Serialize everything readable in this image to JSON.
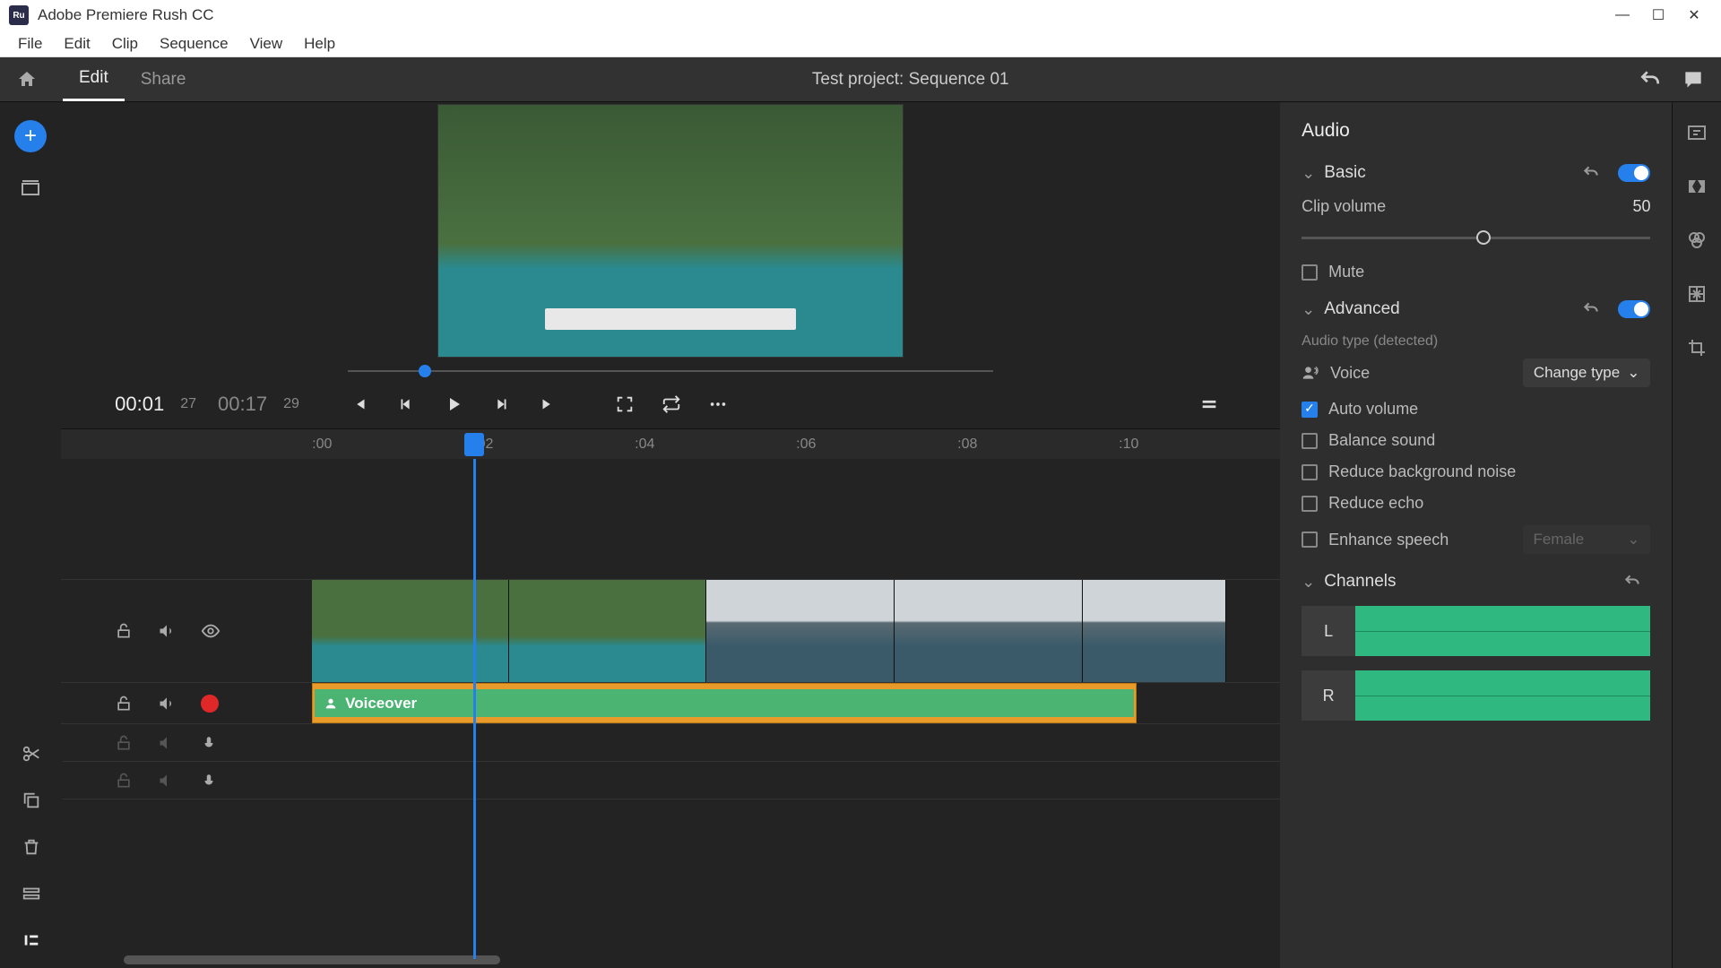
{
  "window": {
    "title": "Adobe Premiere Rush CC",
    "logo": "Ru"
  },
  "menubar": [
    "File",
    "Edit",
    "Clip",
    "Sequence",
    "View",
    "Help"
  ],
  "topbar": {
    "tabs": [
      "Edit",
      "Share"
    ],
    "activeTab": "Edit",
    "title": "Test project: Sequence 01"
  },
  "transport": {
    "current": "00:01",
    "curF": "27",
    "total": "00:17",
    "totF": "29"
  },
  "ruler": [
    ":00",
    ":02",
    ":04",
    ":06",
    ":08",
    ":10"
  ],
  "voice_track": {
    "label": "Voiceover"
  },
  "panel": {
    "title": "Audio",
    "basic": {
      "title": "Basic",
      "volume_label": "Clip volume",
      "volume_value": "50",
      "mute": "Mute"
    },
    "advanced": {
      "title": "Advanced",
      "detected_label": "Audio type (detected)",
      "voice": "Voice",
      "change": "Change type",
      "auto_volume": "Auto volume",
      "balance": "Balance sound",
      "reduce_noise": "Reduce background noise",
      "reduce_echo": "Reduce echo",
      "enhance": "Enhance speech",
      "gender": "Female"
    },
    "channels": {
      "title": "Channels",
      "left": "L",
      "right": "R"
    }
  }
}
